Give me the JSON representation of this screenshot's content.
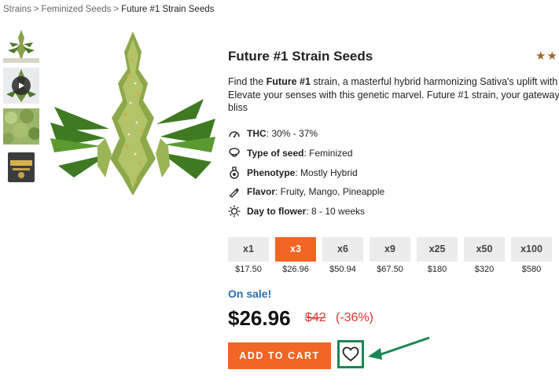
{
  "breadcrumb": {
    "items": [
      "Strains",
      "Feminized Seeds"
    ],
    "separator": ">",
    "current": "Future #1 Strain Seeds"
  },
  "gallery": {
    "thumbnails": [
      "plant-photo",
      "video-thumbnail",
      "field-photo",
      "seed-pack-photo"
    ],
    "main_image": "cannabis-bud-photo"
  },
  "product": {
    "title": "Future #1 Strain Seeds",
    "rating_stars": "★★",
    "rating_color": "#a2692b",
    "description": {
      "line1_a": "Find the ",
      "line1_b": "Future #1",
      "line1_c": " strain, a masterful hybrid harmonizing Sativa's uplift with In",
      "line2": "Elevate your senses with this genetic marvel. Future #1 strain, your gateway t",
      "line3": "bliss"
    },
    "specs": [
      {
        "label": "THC",
        "value": ": 30% - 37%",
        "icon": "gauge-icon"
      },
      {
        "label": "Type of seed",
        "value": ": Feminized",
        "icon": "seed-icon"
      },
      {
        "label": "Phenotype",
        "value": ": Mostly Hybrid",
        "icon": "flask-icon"
      },
      {
        "label": "Flavor",
        "value": ": Fruity, Mango, Pineapple",
        "icon": "dropper-icon"
      },
      {
        "label": "Day to flower",
        "value": ": 8 - 10 weeks",
        "icon": "sun-icon"
      }
    ],
    "packs": [
      {
        "label": "x1",
        "price": "$17.50"
      },
      {
        "label": "x3",
        "price": "$26.96",
        "selected": true
      },
      {
        "label": "x6",
        "price": "$50.94"
      },
      {
        "label": "x9",
        "price": "$67.50"
      },
      {
        "label": "x25",
        "price": "$180"
      },
      {
        "label": "x50",
        "price": "$320"
      },
      {
        "label": "x100",
        "price": "$580"
      }
    ],
    "on_sale_label": "On sale!",
    "price_current": "$26.96",
    "price_original": "$42",
    "discount": "(-36%)",
    "add_to_cart_label": "ADD TO CART",
    "wishlist_icon": "heart-icon"
  },
  "colors": {
    "accent_orange": "#f26522",
    "sale_blue": "#2d6da8",
    "discount_red": "#e3342f",
    "highlight_green": "#1a8753"
  }
}
